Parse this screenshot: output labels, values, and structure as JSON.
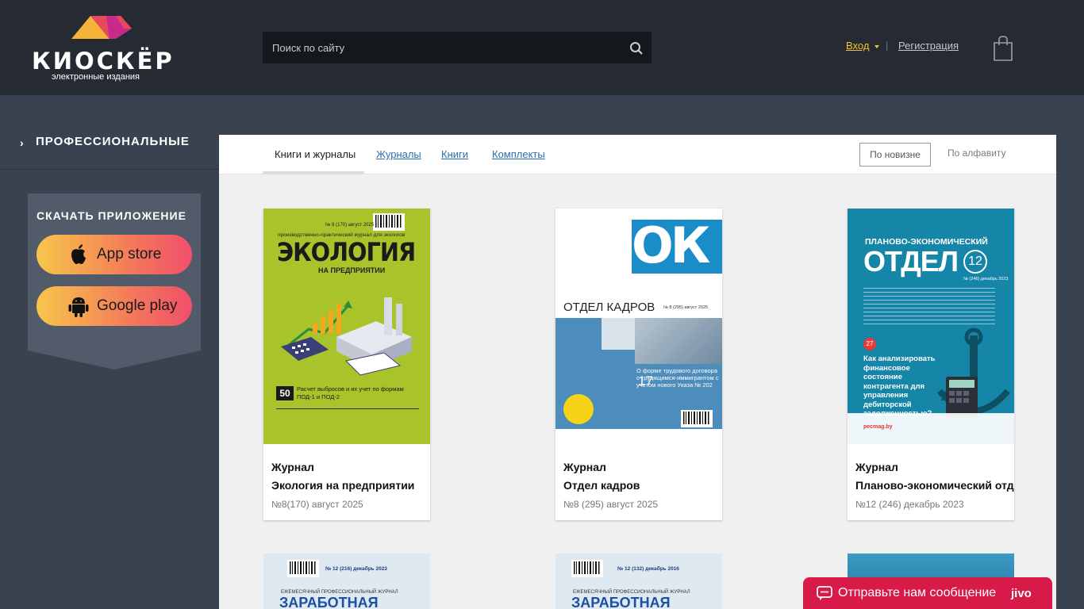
{
  "header": {
    "logo_text": "КИОСКЁР",
    "logo_subtitle": "электронные издания",
    "search_placeholder": "Поиск по сайту",
    "login_label": "Вход",
    "separator": "|",
    "register_label": "Регистрация"
  },
  "sidebar": {
    "category_chevron": "›",
    "category_label": "ПРОФЕССИОНАЛЬНЫЕ",
    "app_title": "СКАЧАТЬ ПРИЛОЖЕНИЕ",
    "app_store_label": "App store",
    "google_play_label": "Google play"
  },
  "main": {
    "tabs": [
      {
        "label": "Книги и журналы"
      },
      {
        "label": "Журналы"
      },
      {
        "label": "Книги"
      },
      {
        "label": "Комплекты"
      }
    ],
    "sort_new": "По новизне",
    "sort_alpha": "По алфавиту",
    "cards": [
      {
        "type": "Журнал",
        "name": "Экология на предприятии",
        "issue": "№8(170) август 2025",
        "cover": {
          "header_small": "№ 8 (170) август 2025",
          "header_tagline": "производственно-практический журнал для экологов",
          "title": "ЭКОЛОГИЯ",
          "subtitle": "НА ПРЕДПРИЯТИИ",
          "badge": "50",
          "badge_text": "Расчет выбросов и их учет по формам ПОД-1 и ПОД-2",
          "bg_color": "#a8c42a"
        }
      },
      {
        "type": "Журнал",
        "name": "Отдел кадров",
        "issue": "№8 (295) август 2025",
        "cover": {
          "logo": "ОК",
          "title": "ОТДЕЛ КАДРОВ",
          "issue_small": "№ 8 (295) август 2025",
          "feature": "О форме трудового договора с трудящимся-иммигрантом с учетом нового Указа № 202",
          "page": "17",
          "accent_color": "#1a8cc8"
        }
      },
      {
        "type": "Журнал",
        "name": "Планово-экономический отдел",
        "issue": "№12 (246) декабрь 2023",
        "cover": {
          "title_top": "ПЛАНОВО-ЭКОНОМИЧЕСКИЙ",
          "title": "ОТДЕЛ",
          "number": "12",
          "issue_small": "№ (246) декабрь 2023",
          "badge": "27",
          "feature": "Как анализировать финансовое состояние контрагента для управления дебиторской задолженностью?",
          "site": "pecmag.by",
          "bg_color": "#1586a8"
        }
      }
    ],
    "partial_cards": [
      {
        "issue_small": "№ 12 (216) декабрь 2023",
        "tagline": "ЕЖЕМЕСЯЧНЫЙ ПРОФЕССИОНАЛЬНЫЙ ЖУРНАЛ",
        "title": "ЗАРАБОТНАЯ"
      },
      {
        "issue_small": "№ 12 (132) декабрь 2016",
        "tagline": "ЕЖЕМЕСЯЧНЫЙ ПРОФЕССИОНАЛЬНЫЙ ЖУРНАЛ",
        "title": "ЗАРАБОТНАЯ"
      },
      {
        "title": ""
      }
    ]
  },
  "chat": {
    "label": "Отправьте нам сообщение",
    "brand": "jivo",
    "color": "#d81a48"
  },
  "colors": {
    "header_bg": "#262b33",
    "body_bg": "#3a4250",
    "login_accent": "#f2c230",
    "link": "#2a6fb0"
  }
}
